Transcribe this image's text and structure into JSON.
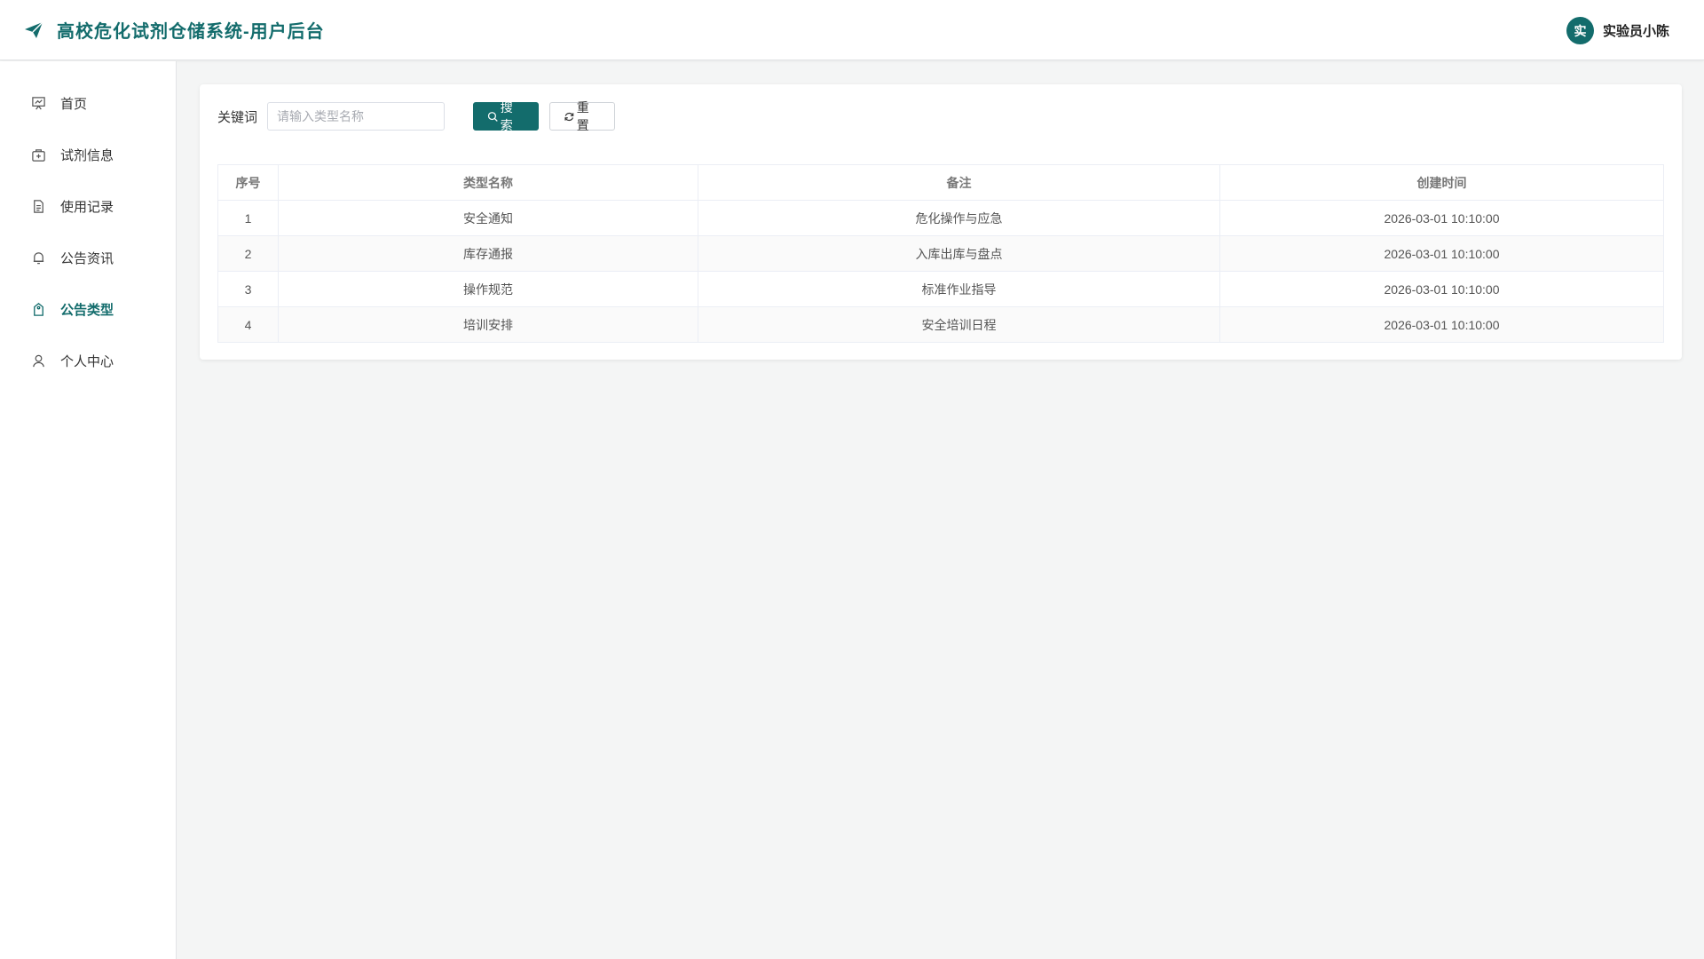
{
  "header": {
    "title": "高校危化试剂仓储系统-用户后台",
    "avatar_char": "实",
    "user_name": "实验员小陈",
    "brand_color": "#136c6c"
  },
  "sidebar": {
    "items": [
      {
        "label": "首页",
        "icon": "presentation-board-icon"
      },
      {
        "label": "试剂信息",
        "icon": "medical-kit-icon"
      },
      {
        "label": "使用记录",
        "icon": "document-icon"
      },
      {
        "label": "公告资讯",
        "icon": "bell-icon"
      },
      {
        "label": "公告类型",
        "icon": "tag-icon",
        "active": true
      },
      {
        "label": "个人中心",
        "icon": "user-icon"
      }
    ]
  },
  "search": {
    "keyword_label": "关键词",
    "placeholder": "请输入类型名称",
    "value": "",
    "search_label": "搜索",
    "reset_label": "重置"
  },
  "table": {
    "columns": [
      "序号",
      "类型名称",
      "备注",
      "创建时间"
    ],
    "rows": [
      [
        "1",
        "安全通知",
        "危化操作与应急",
        "2026-03-01 10:10:00"
      ],
      [
        "2",
        "库存通报",
        "入库出库与盘点",
        "2026-03-01 10:10:00"
      ],
      [
        "3",
        "操作规范",
        "标准作业指导",
        "2026-03-01 10:10:00"
      ],
      [
        "4",
        "培训安排",
        "安全培训日程",
        "2026-03-01 10:10:00"
      ]
    ]
  }
}
